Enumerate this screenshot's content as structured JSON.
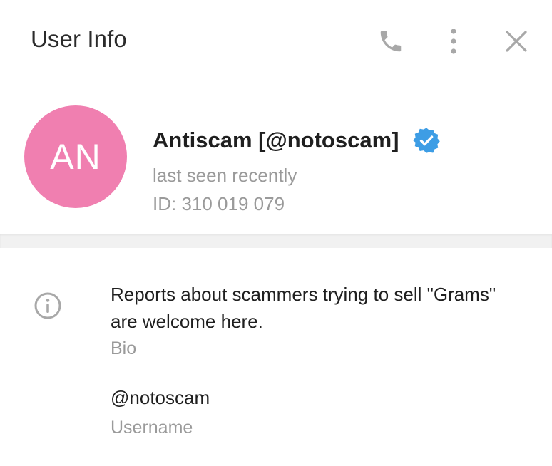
{
  "header": {
    "title": "User Info",
    "icons": {
      "call": "phone-icon",
      "more": "more-vertical-icon",
      "close": "close-icon"
    }
  },
  "profile": {
    "avatar_initials": "AN",
    "avatar_color": "#f07fb0",
    "name": "Antiscam [@notoscam]",
    "verified_icon": "verified-badge-icon",
    "verified_color": "#3d9de5",
    "status": "last seen recently",
    "id_text": "ID: 310 019 079"
  },
  "info": {
    "icon": "info-circle-icon",
    "bio": {
      "text": "Reports about scammers trying to sell \"Grams\" are welcome here.",
      "label": "Bio"
    },
    "username": {
      "value": "@notoscam",
      "label": "Username"
    }
  },
  "colors": {
    "icon_gray": "#a8a8a8",
    "secondary_text": "#9a9a9a",
    "divider": "#f1f1f1"
  }
}
